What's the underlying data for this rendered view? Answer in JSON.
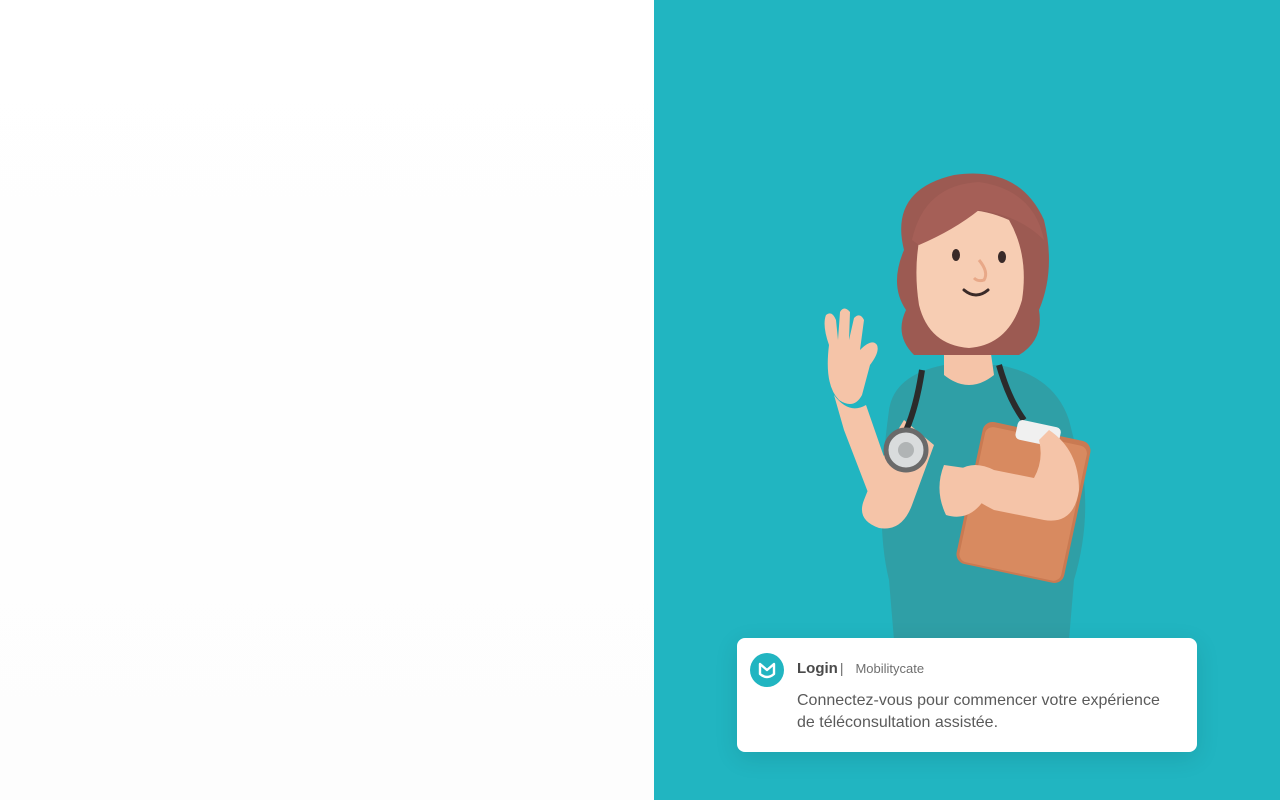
{
  "card": {
    "title": "Login",
    "separator": "|",
    "brand": "Mobilitycate",
    "description": "Connectez-vous pour commencer votre expérience de téléconsultation assistée."
  },
  "colors": {
    "accent": "#21b5c1",
    "card_background": "#ffffff",
    "left_background": "#fefefe"
  },
  "icons": {
    "logo": "mobilitycate-logo-icon"
  },
  "illustration": {
    "subject": "nurse-waving-illustration"
  }
}
